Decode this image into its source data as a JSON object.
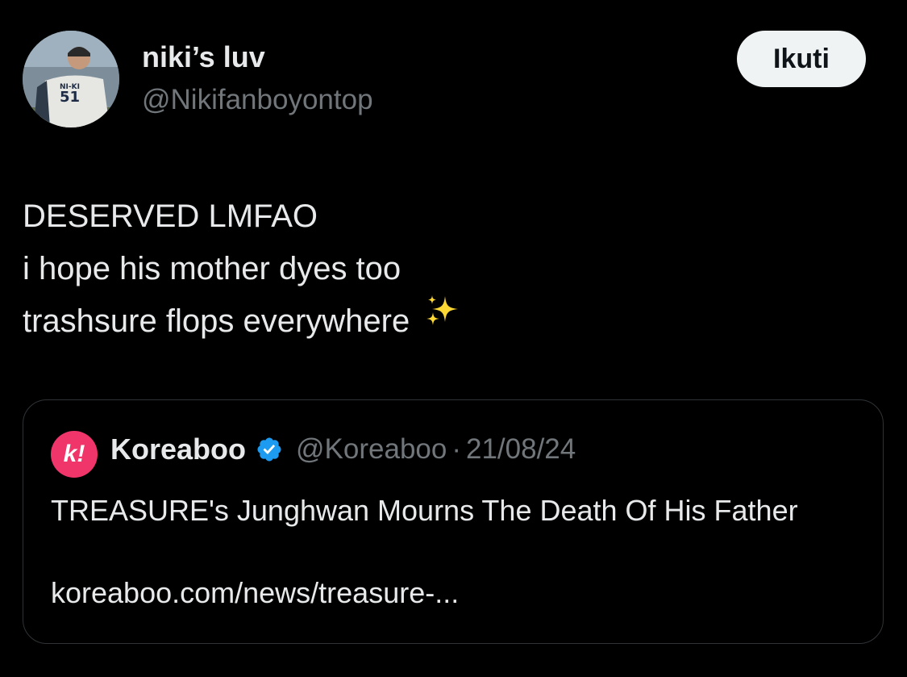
{
  "author": {
    "display_name": "niki’s luv",
    "handle": "@Nikifanboyontop",
    "avatar_icon": "user-avatar"
  },
  "follow_button": {
    "label": "Ikuti"
  },
  "tweet": {
    "lines": [
      "DESERVED LMFAO",
      "i hope his mother dyes too",
      "trashsure flops everywhere"
    ],
    "emoji": "sparkles-icon"
  },
  "quoted_tweet": {
    "avatar_letter": "k!",
    "avatar_color": "#f0356a",
    "name": "Koreaboo",
    "verified": true,
    "verified_color": "#1d9bf0",
    "handle": "@Koreaboo",
    "separator": "·",
    "date": "21/08/24",
    "text": "TREASURE's Junghwan Mourns The Death Of His Father",
    "link": "koreaboo.com/news/treasure-..."
  },
  "colors": {
    "background": "#000000",
    "primary_text": "#e7e9ea",
    "secondary_text": "#71767b",
    "border": "#2f3336",
    "button_bg": "#eff3f4"
  }
}
